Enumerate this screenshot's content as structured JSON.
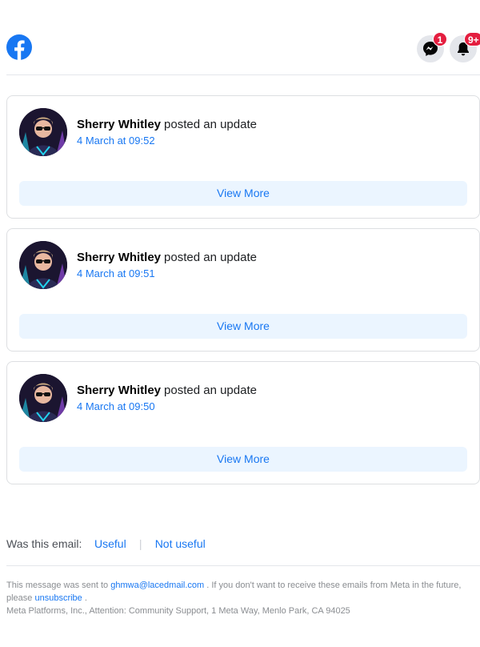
{
  "header": {
    "logo": "facebook-logo",
    "messenger_badge": "1",
    "notifications_badge": "9+"
  },
  "notifications": [
    {
      "name": "Sherry Whitley",
      "action": "posted an update",
      "time": "4 March at 09:52",
      "button": "View More"
    },
    {
      "name": "Sherry Whitley",
      "action": "posted an update",
      "time": "4 March at 09:51",
      "button": "View More"
    },
    {
      "name": "Sherry Whitley",
      "action": "posted an update",
      "time": "4 March at 09:50",
      "button": "View More"
    }
  ],
  "feedback": {
    "question": "Was this email:",
    "useful": "Useful",
    "separator": "|",
    "not_useful": "Not useful"
  },
  "footer": {
    "prefix": "This message was sent to",
    "email": "ghmwa@lacedmail.com",
    "middle": ". If you don't want to receive these emails from Meta in the future, please",
    "unsubscribe": "unsubscribe",
    "suffix": ".",
    "address": "Meta Platforms, Inc., Attention: Community Support, 1 Meta Way, Menlo Park, CA 94025"
  },
  "colors": {
    "brand": "#1877f2",
    "badge": "#e41e3f",
    "button_bg": "#ebf5ff"
  }
}
